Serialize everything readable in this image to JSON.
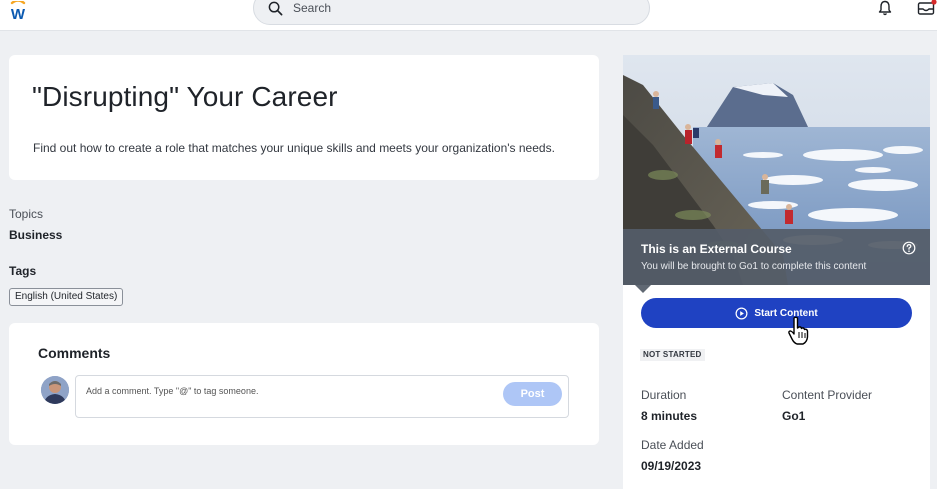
{
  "header": {
    "logo_letter": "W",
    "search_placeholder": "Search"
  },
  "course": {
    "title": "\"Disrupting\" Your Career",
    "description": "Find out how to create a role that matches your unique skills and meets your organization's needs."
  },
  "topics": {
    "label": "Topics",
    "value": "Business"
  },
  "tags": {
    "label": "Tags",
    "items": [
      "English (United States)"
    ]
  },
  "comments": {
    "title": "Comments",
    "placeholder": "Add a comment. Type \"@\" to tag someone.",
    "post_label": "Post"
  },
  "external": {
    "title": "This is an External Course",
    "subtitle": "You will be brought to Go1 to complete this content"
  },
  "start_button": {
    "label": "Start Content"
  },
  "status": "NOT STARTED",
  "details": {
    "duration_label": "Duration",
    "duration_value": "8 minutes",
    "provider_label": "Content Provider",
    "provider_value": "Go1",
    "date_label": "Date Added",
    "date_value": "09/19/2023"
  },
  "colors": {
    "accent": "#1f42c2",
    "post_disabled": "#aec6f6",
    "banner": "#545c68",
    "page_bg": "#eef0f3"
  },
  "icons": [
    "workday-logo-icon",
    "search-icon",
    "bell-icon",
    "inbox-icon",
    "help-circle-icon",
    "play-circle-icon",
    "hand-cursor-icon"
  ]
}
